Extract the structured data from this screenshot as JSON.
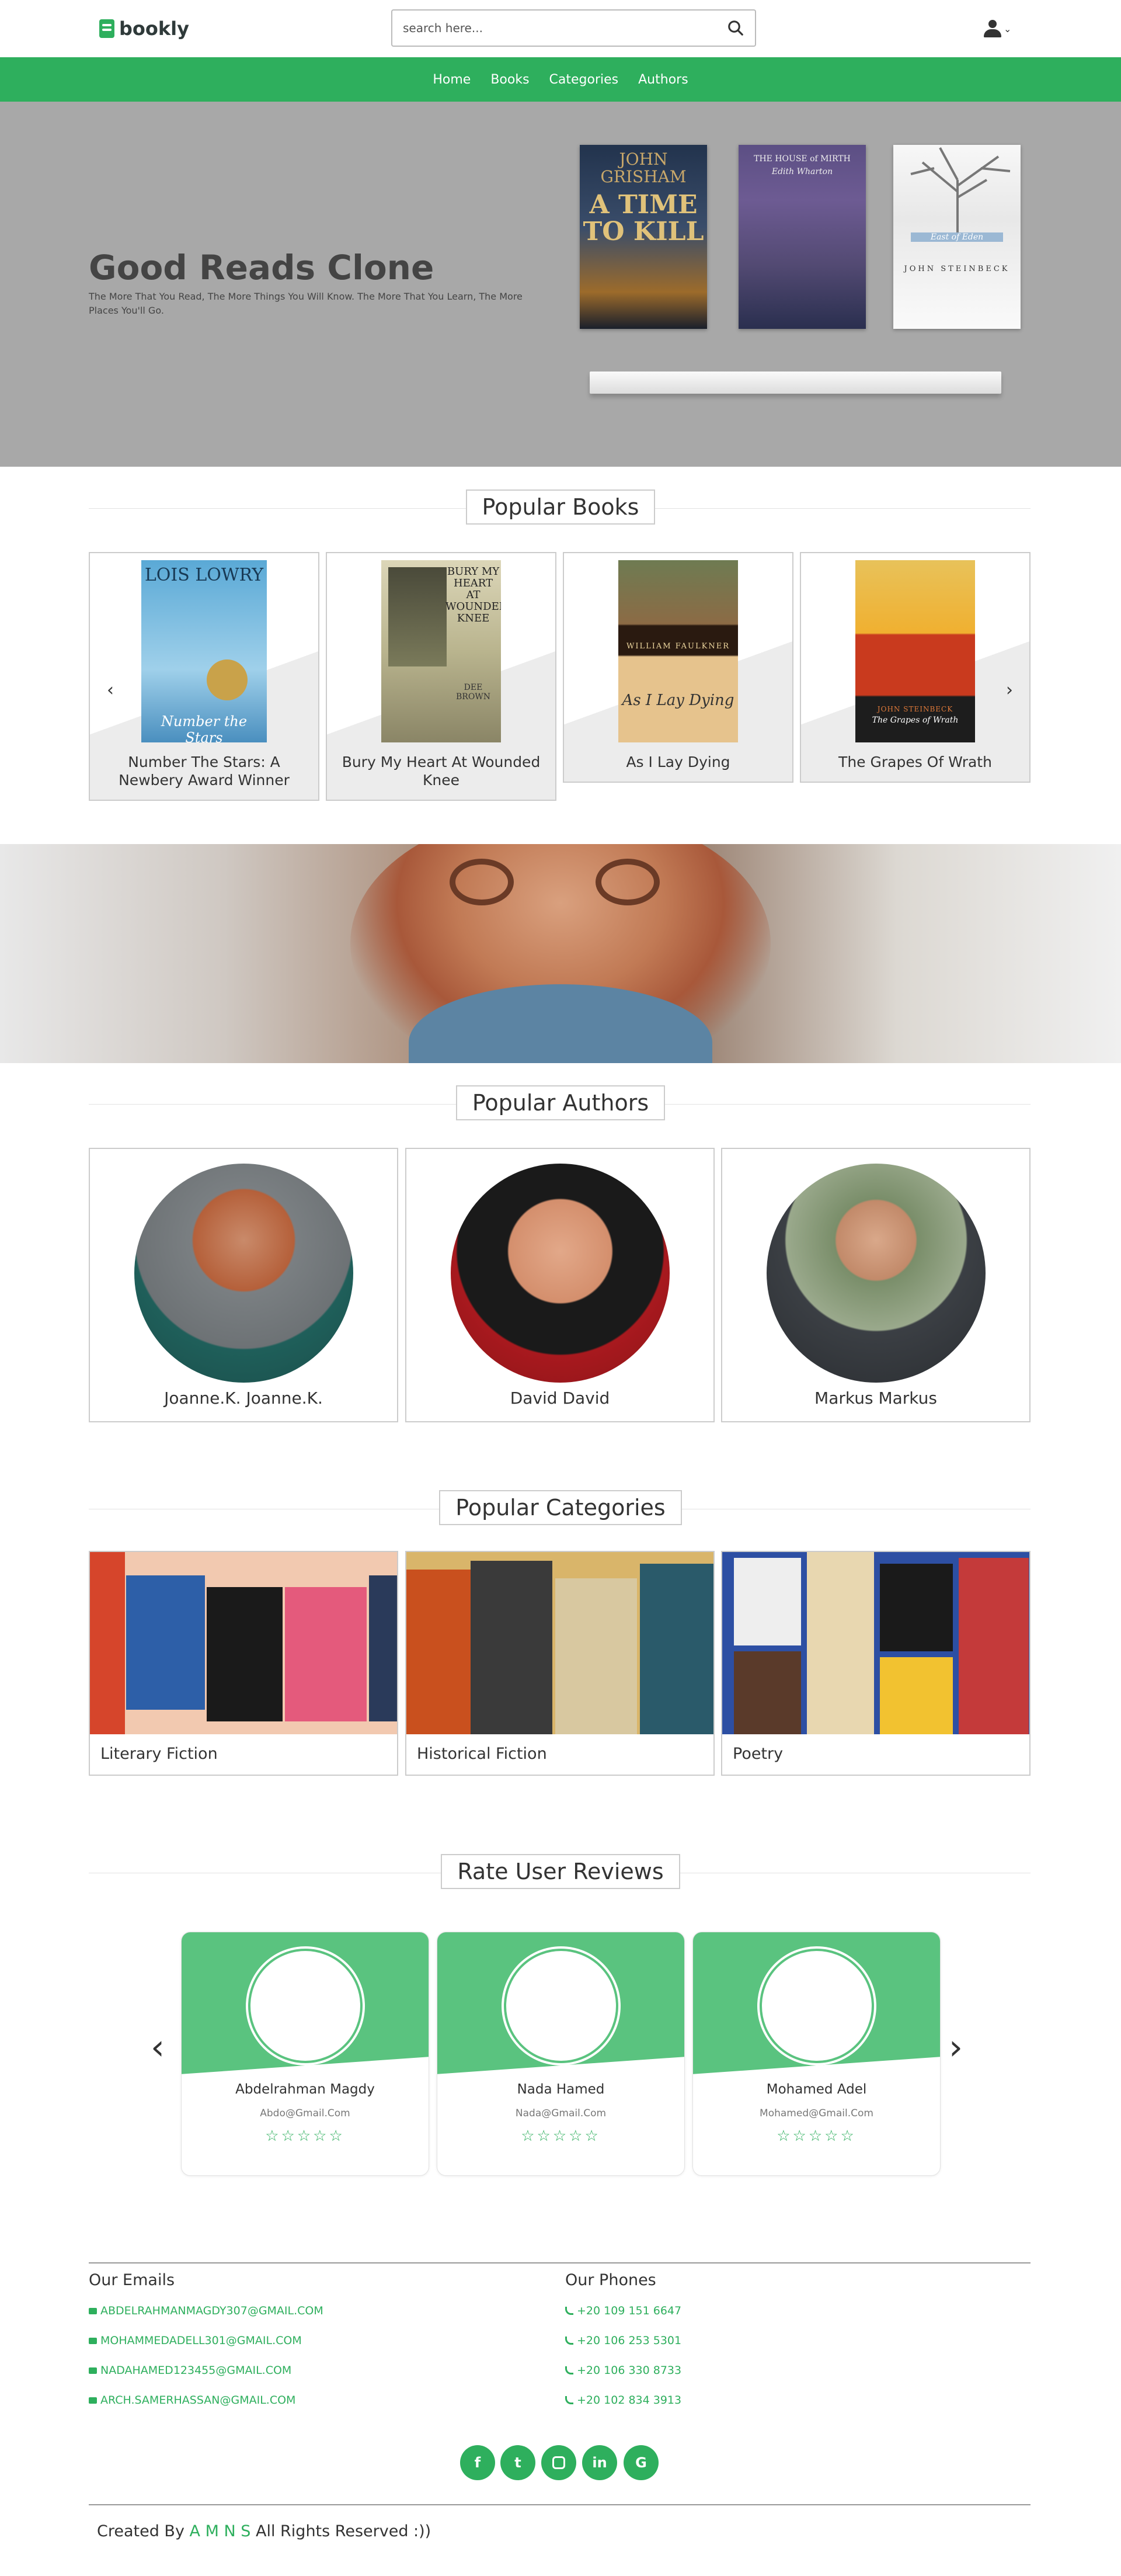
{
  "header": {
    "logo_text": "bookly",
    "search_placeholder": "search here..."
  },
  "nav": {
    "items": [
      "Home",
      "Books",
      "Categories",
      "Authors"
    ]
  },
  "hero": {
    "title": "Good Reads Clone",
    "subtitle": "The More That You Read, The More Things You Will Know. The More That You Learn, The More Places You'll Go.",
    "books": [
      {
        "author": "JOHN GRISHAM",
        "title": "A TIME TO KILL"
      },
      {
        "title": "THE HOUSE of MIRTH",
        "author": "Edith Wharton"
      },
      {
        "title": "East of Eden",
        "author": "JOHN STEINBECK"
      }
    ]
  },
  "popular_books": {
    "title": "Popular Books",
    "items": [
      {
        "title": "Number The Stars: A Newbery Award Winner",
        "cover_author": "LOIS LOWRY",
        "cover_title": "Number the Stars"
      },
      {
        "title": "Bury My Heart At Wounded Knee",
        "cover_title": "BURY MY HEART AT WOUNDED KNEE",
        "cover_author": "DEE BROWN"
      },
      {
        "title": "As I Lay Dying",
        "cover_author": "WILLIAM FAULKNER",
        "cover_title": "As I Lay Dying"
      },
      {
        "title": "The Grapes Of Wrath",
        "cover_author": "JOHN STEINBECK",
        "cover_title": "The Grapes of Wrath"
      }
    ]
  },
  "popular_authors": {
    "title": "Popular Authors",
    "items": [
      {
        "name": "Joanne.K. Joanne.K."
      },
      {
        "name": "David David"
      },
      {
        "name": "Markus Markus"
      }
    ]
  },
  "popular_categories": {
    "title": "Popular Categories",
    "items": [
      {
        "name": "Literary Fiction"
      },
      {
        "name": "Historical Fiction"
      },
      {
        "name": "Poetry"
      }
    ]
  },
  "reviews": {
    "title": "Rate User Reviews",
    "items": [
      {
        "name": "Abdelrahman Magdy",
        "email": "Abdo@Gmail.Com",
        "stars": "☆☆☆☆☆"
      },
      {
        "name": "Nada Hamed",
        "email": "Nada@Gmail.Com",
        "stars": "☆☆☆☆☆"
      },
      {
        "name": "Mohamed Adel",
        "email": "Mohamed@Gmail.Com",
        "stars": "☆☆☆☆☆"
      }
    ]
  },
  "footer": {
    "emails_title": "Our Emails",
    "emails": [
      "ABDELRAHMANMAGDY307@GMAIL.COM",
      "MOHAMMEDADELL301@GMAIL.COM",
      "NADAHAMED123455@GMAIL.COM",
      "ARCH.SAMERHASSAN@GMAIL.COM"
    ],
    "phones_title": "Our Phones",
    "phones": [
      "+20 109 151 6647",
      "+20 106 253 5301",
      "+20 106 330 8733",
      "+20 102 834 3913"
    ],
    "social": [
      "facebook-icon",
      "twitter-icon",
      "instagram-icon",
      "linkedin-icon",
      "google-icon"
    ],
    "credits_prefix": "Created By",
    "credits_name": "A M N S",
    "credits_suffix": "All Rights Reserved :))"
  },
  "colors": {
    "accent": "#2eaf5d",
    "hero_bg": "#a8a8a8",
    "review_top": "#5ac37f"
  }
}
